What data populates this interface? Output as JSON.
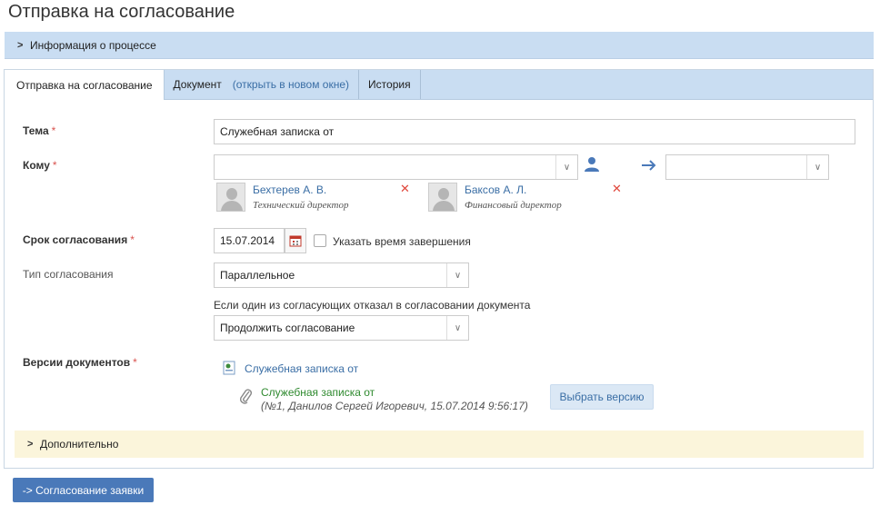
{
  "page": {
    "title": "Отправка на согласование"
  },
  "info_bar": {
    "label": "Информация о процессе"
  },
  "tabs": [
    {
      "label": "Отправка на согласование"
    },
    {
      "label": "Документ",
      "link": "(открыть в новом окне)"
    },
    {
      "label": "История"
    }
  ],
  "form": {
    "subject": {
      "label": "Тема",
      "required": "*",
      "value": "Служебная записка от"
    },
    "to": {
      "label": "Кому",
      "required": "*",
      "value": "",
      "forward_value": "",
      "recipients": [
        {
          "name": "Бехтерев А. В.",
          "role": "Технический директор"
        },
        {
          "name": "Баксов А. Л.",
          "role": "Финансовый директор"
        }
      ],
      "remove_glyph": "✕"
    },
    "deadline": {
      "label": "Срок согласования",
      "required": "*",
      "value": "15.07.2014",
      "checkbox_label": "Указать время завершения"
    },
    "approval_type": {
      "label": "Тип согласования",
      "value": "Параллельное"
    },
    "on_reject": {
      "label": "Если один из согласующих отказал в согласовании документа",
      "value": "Продолжить согласование"
    },
    "versions": {
      "label": "Версии документов",
      "required": "*",
      "document_link": "Служебная записка от",
      "attachment_name": "Служебная записка от",
      "attachment_meta": "(№1, Данилов Сергей Игоревич, 15.07.2014 9:56:17)",
      "select_version_button": "Выбрать версию"
    }
  },
  "extra_bar": {
    "label": "Дополнительно"
  },
  "submit_button": {
    "label": "-> Согласование заявки"
  },
  "colors": {
    "accent": "#4a79b9",
    "header_bg": "#c9ddf2",
    "required": "#d9534f",
    "extra_bg": "#fbf5db"
  }
}
